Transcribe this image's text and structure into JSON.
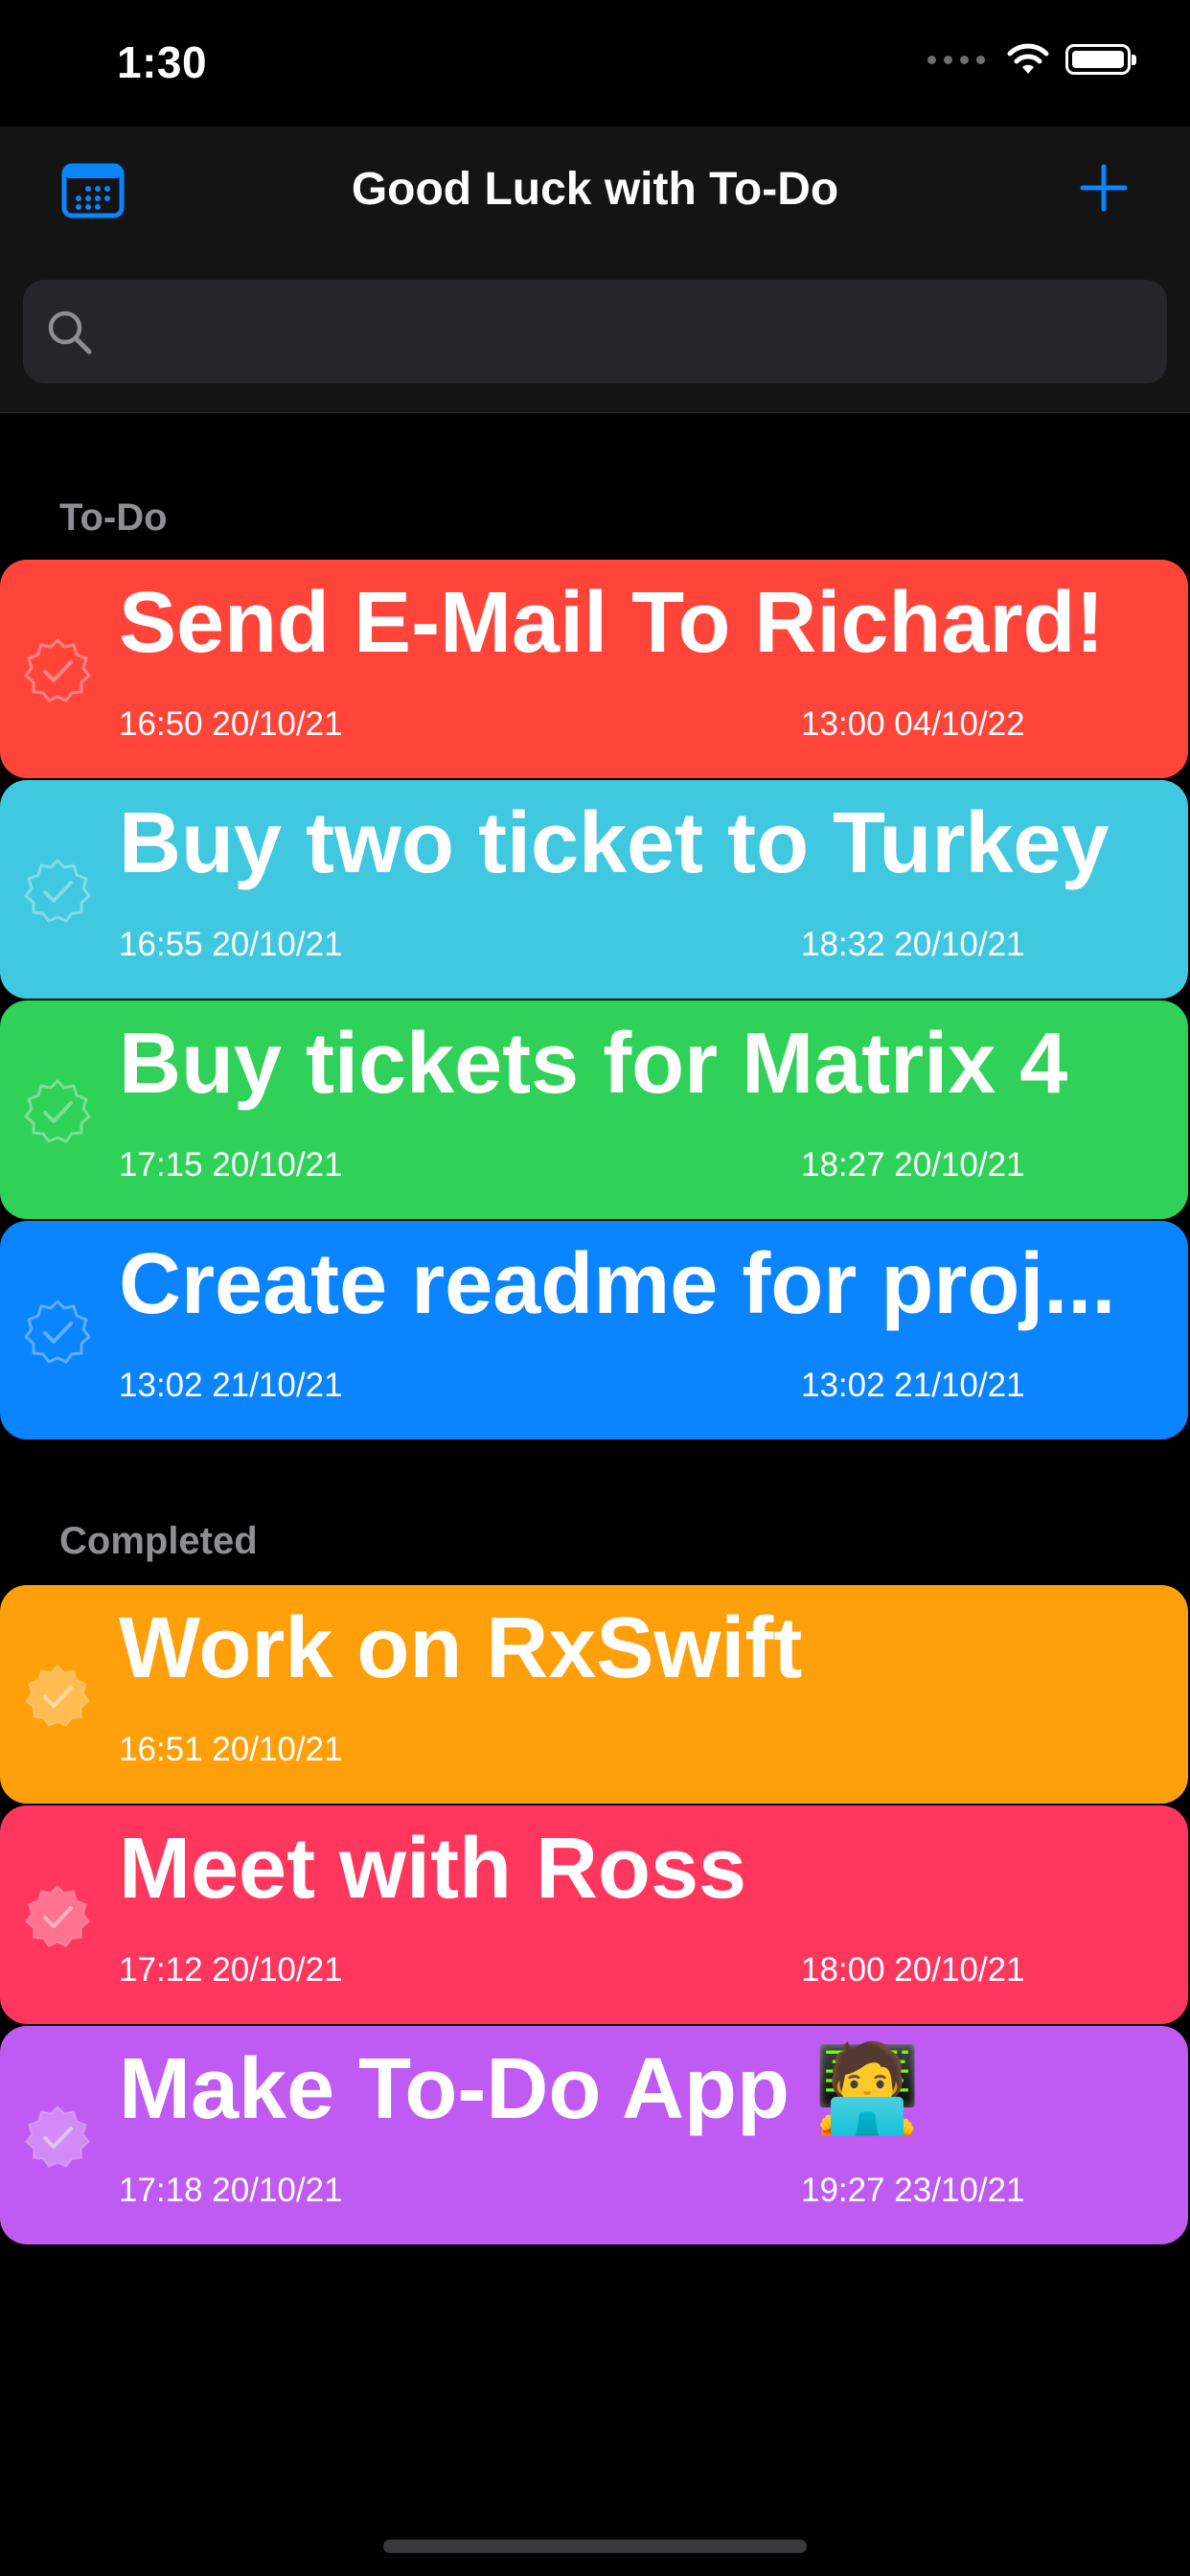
{
  "status_bar": {
    "time": "1:30"
  },
  "nav": {
    "title": "Good Luck with To-Do"
  },
  "search": {
    "placeholder": ""
  },
  "sections": {
    "todo": "To-Do",
    "completed": "Completed"
  },
  "todo_items": [
    {
      "title": "Send E-Mail To Richard!",
      "created": "16:50 20/10/21",
      "due": "13:00 04/10/22",
      "color": "#ff453a"
    },
    {
      "title": "Buy two ticket to Turkey",
      "created": "16:55 20/10/21",
      "due": "18:32 20/10/21",
      "color": "#40c8e0"
    },
    {
      "title": "Buy tickets for Matrix 4",
      "created": "17:15 20/10/21",
      "due": "18:27 20/10/21",
      "color": "#30d158"
    },
    {
      "title": "Create readme for proj...",
      "created": "13:02 21/10/21",
      "due": "13:02 21/10/21",
      "color": "#0a84ff"
    }
  ],
  "completed_items": [
    {
      "title": "Work on RxSwift",
      "created": "16:51 20/10/21",
      "due": "",
      "color": "#ff9f0a"
    },
    {
      "title": "Meet with Ross",
      "created": "17:12 20/10/21",
      "due": "18:00 20/10/21",
      "color": "#ff375f"
    },
    {
      "title": "Make To-Do App 🧑‍💻",
      "created": "17:18 20/10/21",
      "due": "19:27 23/10/21",
      "color": "#bf5af2"
    }
  ],
  "icons": {
    "calendar": "calendar-icon",
    "add": "plus-icon",
    "search": "magnifying-glass-icon",
    "check": "checkmark-seal-icon"
  },
  "accent_color": "#0a84ff"
}
